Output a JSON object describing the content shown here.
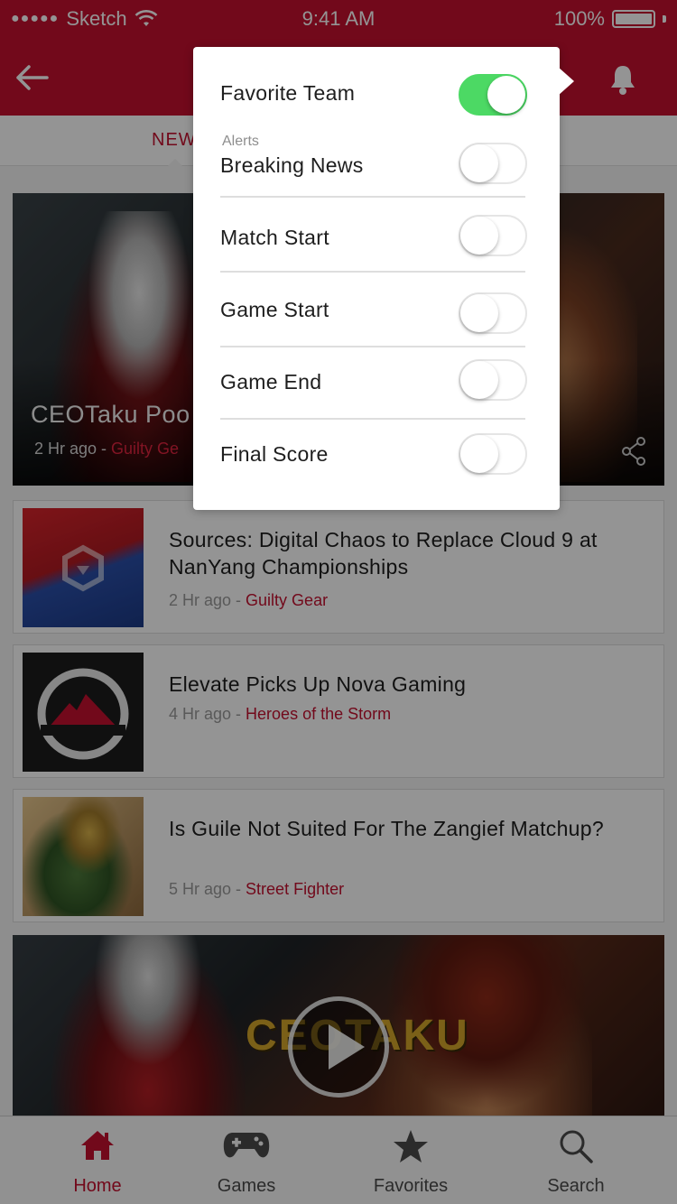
{
  "status_bar": {
    "carrier": "Sketch",
    "time": "9:41 AM",
    "battery": "100%"
  },
  "colors": {
    "brand": "#c4102f",
    "toggle_on": "#4cd964",
    "category_text": "#c4102f"
  },
  "tabs": {
    "active_partial_label": "NEW"
  },
  "hero": {
    "title": "CEOTaku Poo",
    "time": "2 Hr ago",
    "separator": " - ",
    "category": "Guilty Ge"
  },
  "feed": [
    {
      "headline": "Sources: Digital Chaos to Replace Cloud 9 at NanYang Championships",
      "time": "2 Hr ago",
      "category": "Guilty Gear"
    },
    {
      "headline": "Elevate Picks Up Nova Gaming",
      "time": "4 Hr ago",
      "category": "Heroes of the Storm"
    },
    {
      "headline": "Is Guile Not Suited For The Zangief Matchup?",
      "time": "5 Hr ago",
      "category": "Street Fighter"
    }
  ],
  "video": {
    "logo_text": "CEOTAKU"
  },
  "popover": {
    "favorite": {
      "label": "Favorite Team",
      "on": true
    },
    "alerts_header": "Alerts",
    "alerts": [
      {
        "label": "Breaking News",
        "on": false
      },
      {
        "label": "Match Start",
        "on": false
      },
      {
        "label": "Game Start",
        "on": false
      },
      {
        "label": "Game End",
        "on": false
      },
      {
        "label": "Final Score",
        "on": false
      }
    ]
  },
  "tabbar": [
    {
      "label": "Home",
      "icon": "home-icon",
      "active": true
    },
    {
      "label": "Games",
      "icon": "gamepad-icon",
      "active": false
    },
    {
      "label": "Favorites",
      "icon": "star-icon",
      "active": false
    },
    {
      "label": "Search",
      "icon": "search-icon",
      "active": false
    }
  ]
}
